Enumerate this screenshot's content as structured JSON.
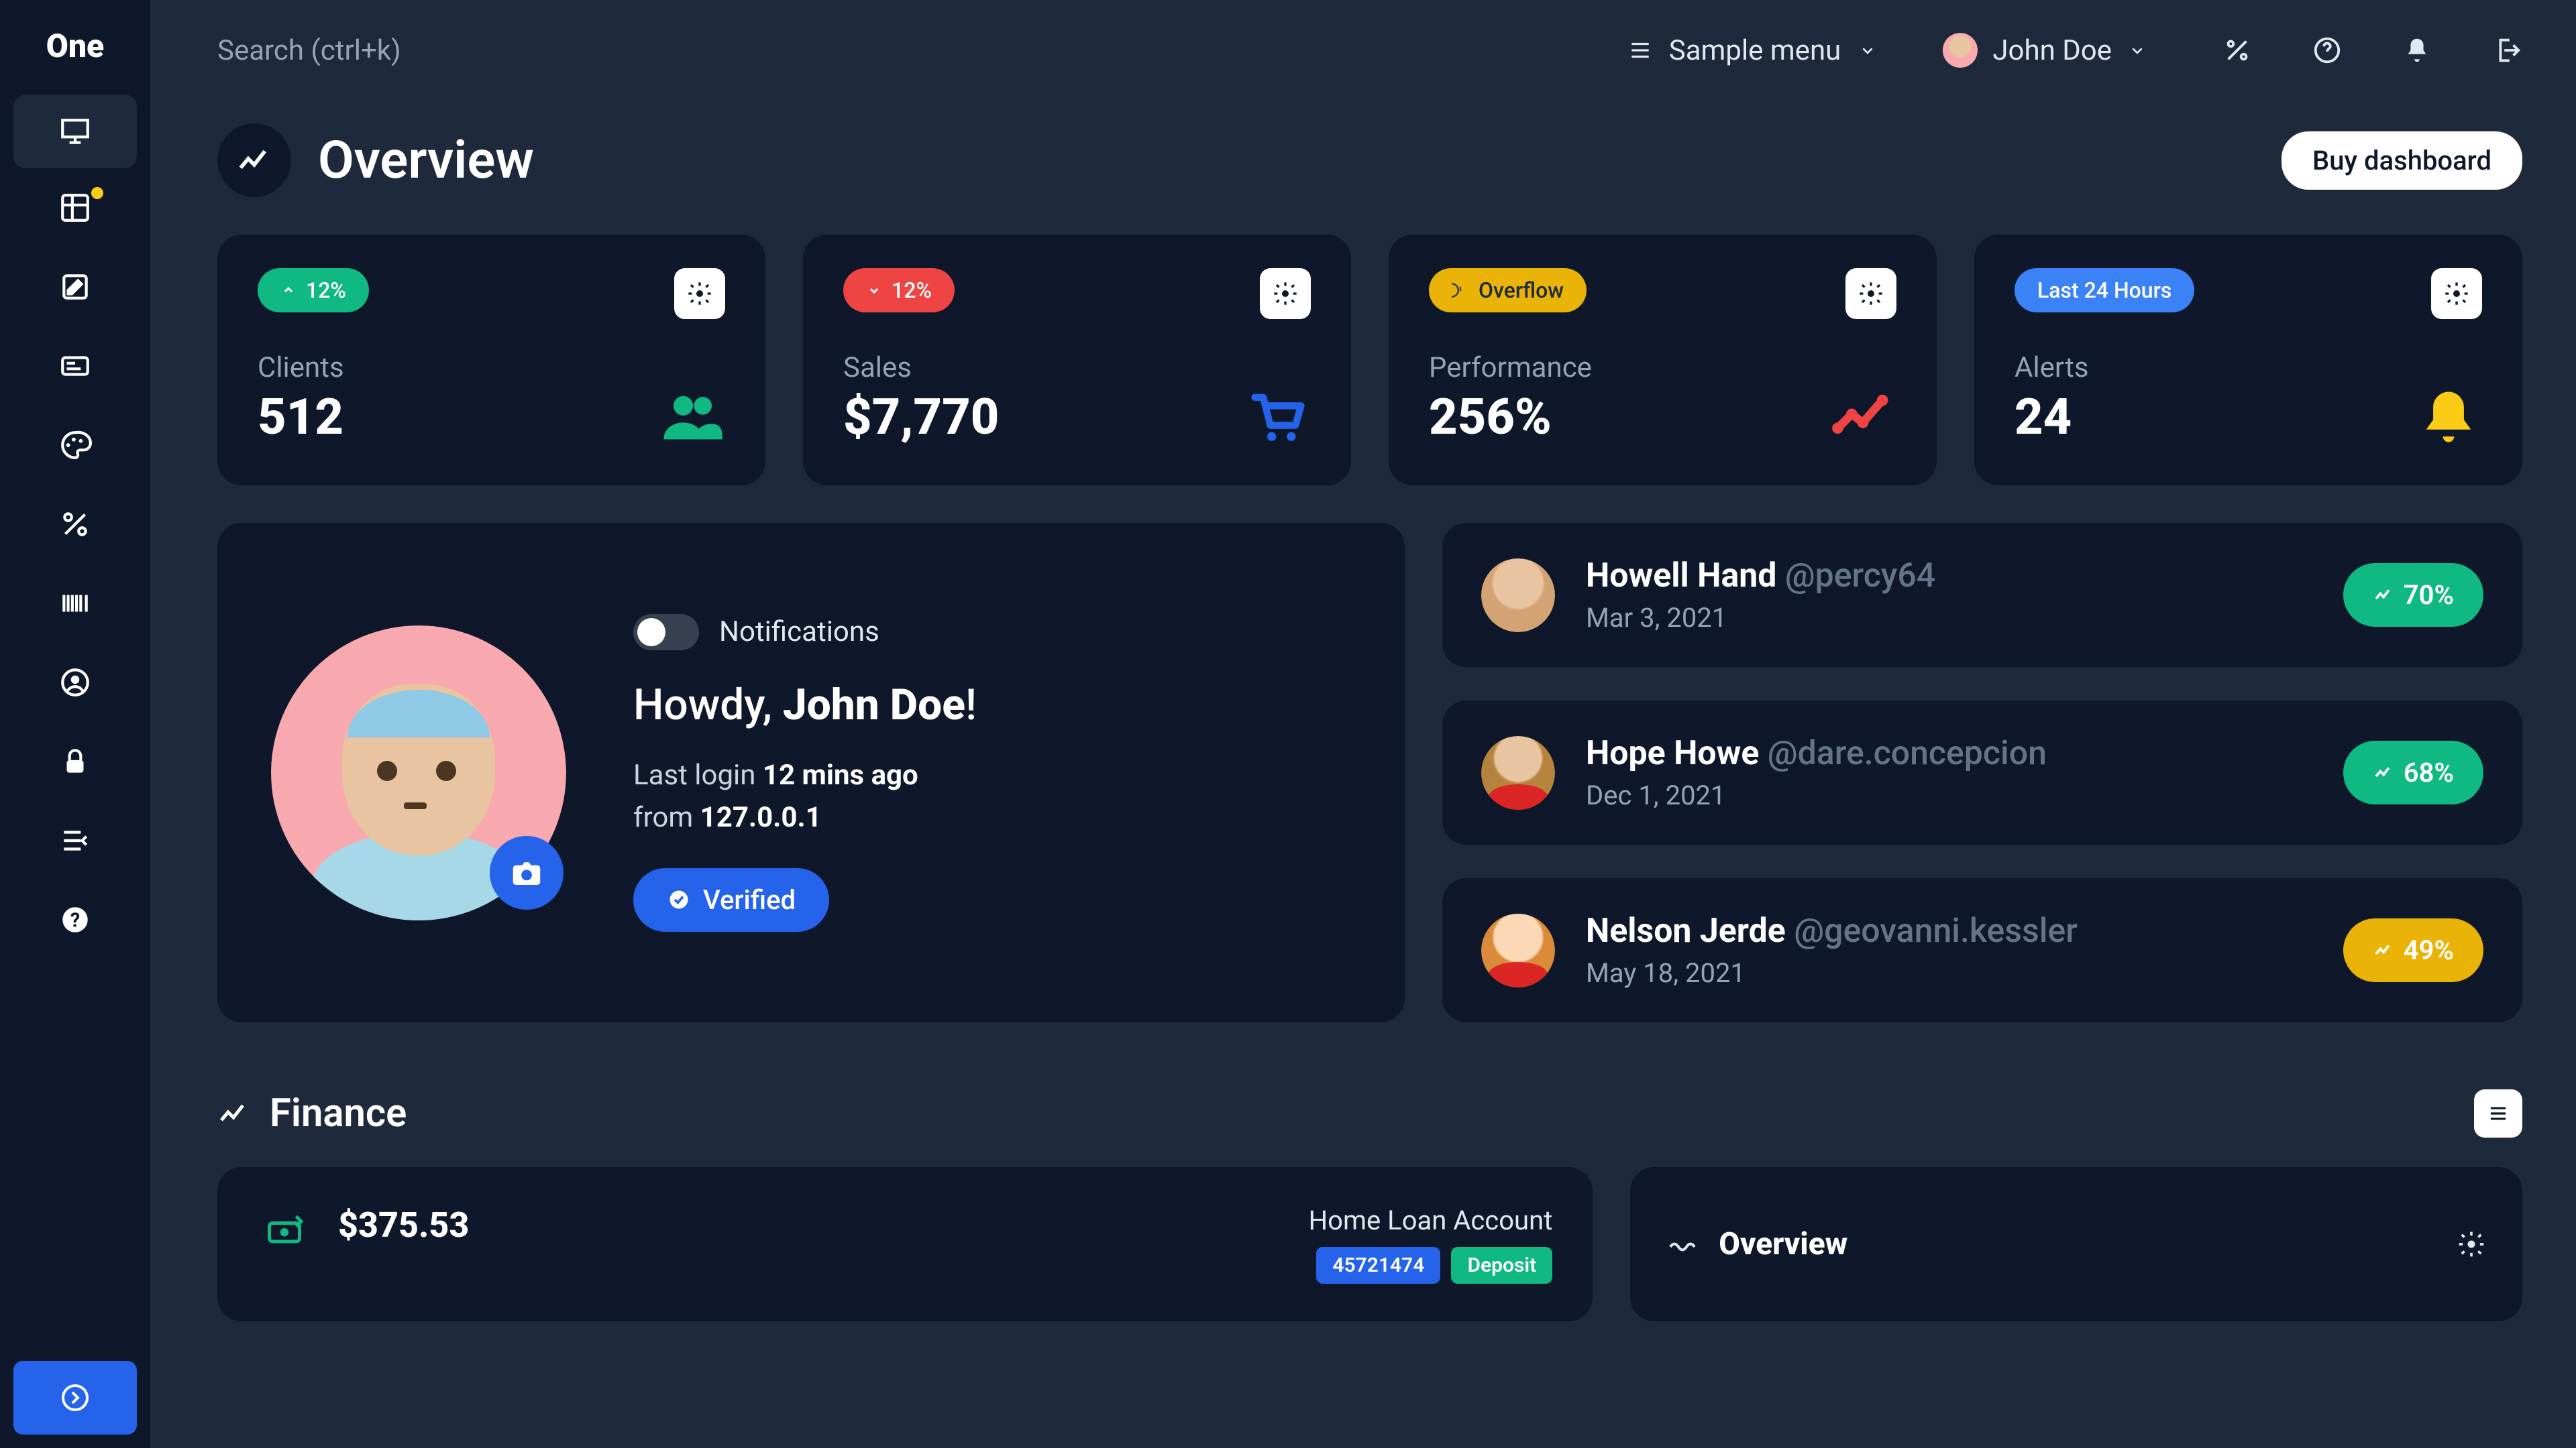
{
  "logo": "One",
  "search": {
    "placeholder": "Search (ctrl+k)"
  },
  "topbar": {
    "menu_label": "Sample menu",
    "user_name": "John Doe"
  },
  "overview": {
    "title": "Overview",
    "buy_label": "Buy dashboard"
  },
  "stats": {
    "clients": {
      "pill": "12%",
      "label": "Clients",
      "value": "512"
    },
    "sales": {
      "pill": "12%",
      "label": "Sales",
      "value": "$7,770"
    },
    "performance": {
      "pill": "Overflow",
      "label": "Performance",
      "value": "256%"
    },
    "alerts": {
      "pill": "Last 24 Hours",
      "label": "Alerts",
      "value": "24"
    }
  },
  "profile": {
    "notif_label": "Notifications",
    "greeting_prefix": "Howdy, ",
    "greeting_name": "John Doe",
    "greeting_suffix": "!",
    "login_prefix": "Last login ",
    "login_time": "12 mins ago",
    "login_from_prefix": "from ",
    "login_ip": "127.0.0.1",
    "verified": "Verified"
  },
  "clients_list": [
    {
      "name": "Howell Hand",
      "handle": "@percy64",
      "date": "Mar 3, 2021",
      "pct": "70%",
      "color": "green"
    },
    {
      "name": "Hope Howe",
      "handle": "@dare.concepcion",
      "date": "Dec 1, 2021",
      "pct": "68%",
      "color": "green"
    },
    {
      "name": "Nelson Jerde",
      "handle": "@geovanni.kessler",
      "date": "May 18, 2021",
      "pct": "49%",
      "color": "yellow"
    }
  ],
  "finance": {
    "title": "Finance",
    "amount": "$375.53",
    "account": "Home Loan Account",
    "tag1": "45721474",
    "tag2": "Deposit",
    "panel_title": "Overview"
  }
}
